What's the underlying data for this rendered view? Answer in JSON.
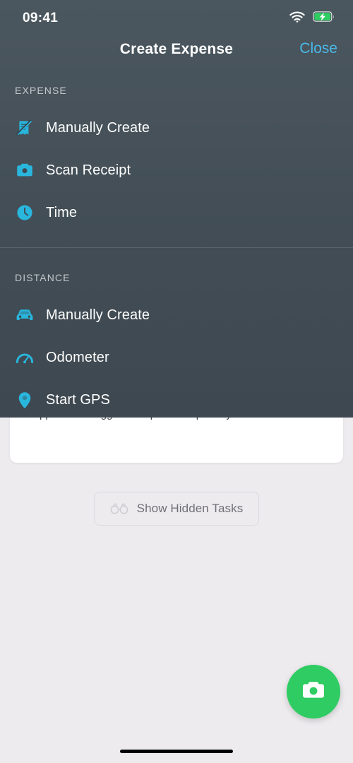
{
  "status_bar": {
    "time": "09:41",
    "wifi_icon": "wifi-icon",
    "battery_icon": "battery-charging-icon"
  },
  "action_sheet": {
    "title": "Create Expense",
    "close_label": "Close",
    "close_color": "#4ab8e8",
    "icon_color": "#29b6dd",
    "background_color": "#47525a",
    "sections": [
      {
        "header": "EXPENSE",
        "items": [
          {
            "label": "Manually Create",
            "icon": "receipt-slashed-icon"
          },
          {
            "label": "Scan Receipt",
            "icon": "camera-icon"
          },
          {
            "label": "Time",
            "icon": "clock-icon"
          }
        ]
      },
      {
        "header": "DISTANCE",
        "items": [
          {
            "label": "Manually Create",
            "icon": "car-icon"
          },
          {
            "label": "Odometer",
            "icon": "gauge-icon"
          },
          {
            "label": "Start GPS",
            "icon": "map-pin-icon"
          }
        ]
      }
    ]
  },
  "background_page": {
    "card_text": "Approve the logged time per tasks per day",
    "hidden_tasks_button": {
      "label": "Show Hidden Tasks",
      "icon": "binoculars-icon"
    },
    "fab": {
      "icon": "camera-icon",
      "color": "#2ecc62"
    }
  }
}
